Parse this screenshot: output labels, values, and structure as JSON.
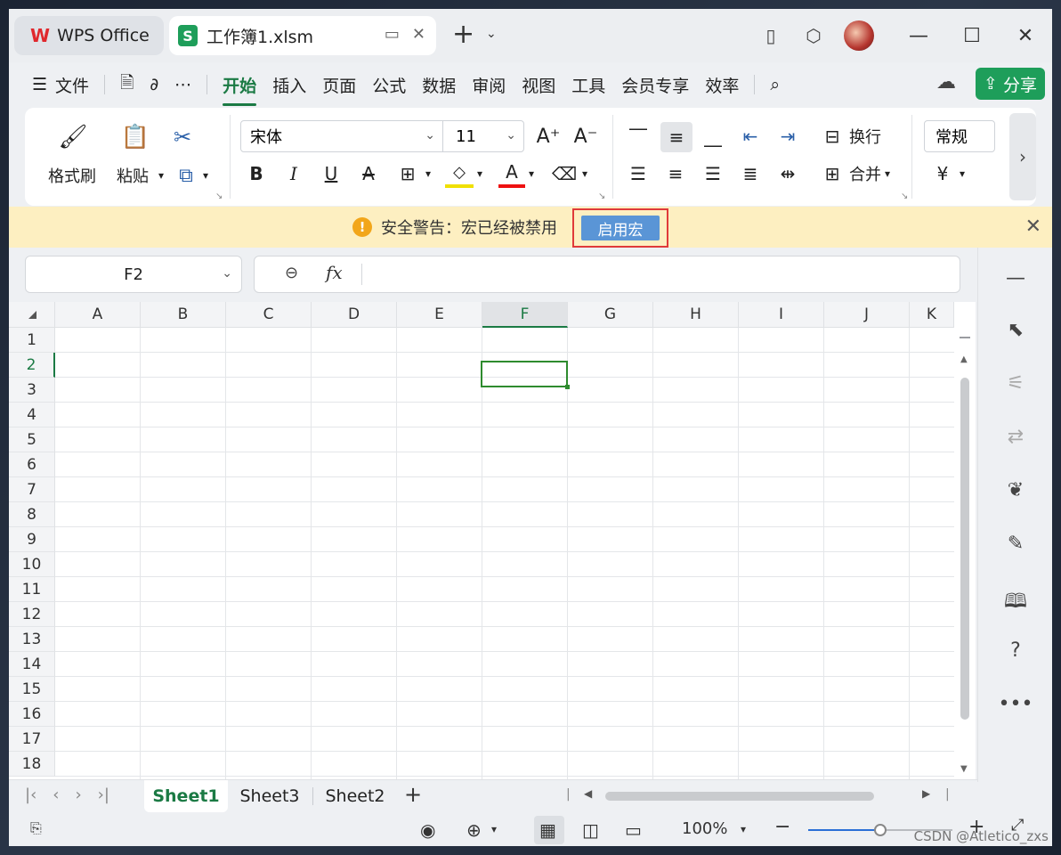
{
  "titlebar": {
    "home_tab": "WPS Office",
    "doc_tab": "工作簿1.xlsm",
    "doc_badge": "S"
  },
  "menu": {
    "items": [
      "文件",
      "开始",
      "插入",
      "页面",
      "公式",
      "数据",
      "审阅",
      "视图",
      "工具",
      "会员专享",
      "效率"
    ],
    "active": "开始",
    "share": "分享"
  },
  "ribbon": {
    "format_painter": "格式刷",
    "paste": "粘贴",
    "font_name": "宋体",
    "font_size": "11",
    "wrap": "换行",
    "merge": "合并",
    "number_format": "常规"
  },
  "warning": {
    "message": "安全警告：宏已经被禁用",
    "enable_button": "启用宏"
  },
  "formula_bar": {
    "name_box": "F2",
    "fx": "fx",
    "content": ""
  },
  "grid": {
    "columns": [
      "A",
      "B",
      "C",
      "D",
      "E",
      "F",
      "G",
      "H",
      "I",
      "J",
      "K"
    ],
    "rows": [
      "1",
      "2",
      "3",
      "4",
      "5",
      "6",
      "7",
      "8",
      "9",
      "10",
      "11",
      "12",
      "13",
      "14",
      "15",
      "16",
      "17",
      "18"
    ],
    "selected_column": "F",
    "selected_row": "2"
  },
  "sheets": {
    "tabs": [
      "Sheet1",
      "Sheet3",
      "Sheet2"
    ],
    "active": "Sheet1"
  },
  "status": {
    "zoom": "100%"
  },
  "watermark": "CSDN @Atletico_zxs",
  "colors": {
    "accent_green": "#1b7a44",
    "share_green": "#1e9e5a",
    "warning_bg": "#fdefc1",
    "enable_button_bg": "#5a95d6",
    "highlight_border": "#e03a3a"
  }
}
